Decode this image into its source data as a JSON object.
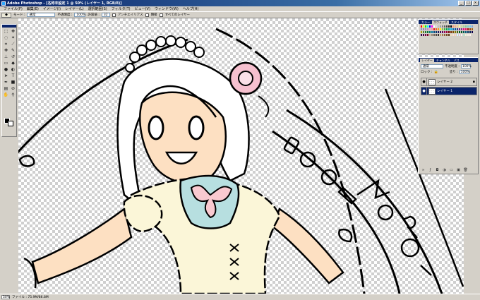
{
  "window": {
    "app_title": "Adobe Photoshop",
    "doc_title": "[名称未設定 1 @ 50% (レイヤー 1, RGB/8)]",
    "controls": [
      "_",
      "□",
      "×"
    ]
  },
  "menu": [
    "ファイル(F)",
    "編集(E)",
    "イメージ(I)",
    "レイヤー(L)",
    "選択範囲(S)",
    "フィルタ(T)",
    "ビュー(V)",
    "ウィンドウ(W)",
    "ヘルプ(H)"
  ],
  "options": {
    "mode_label": "モード :",
    "mode_value": "通常",
    "opacity_label": "不透明度 :",
    "opacity_value": "100%",
    "tolerance_label": "許容値 :",
    "tolerance_value": "32",
    "antialias_label": "アンチエイリアス",
    "contiguous_label": "隣接",
    "all_layers_label": "すべてのレイヤー"
  },
  "status": {
    "zoom": "50%",
    "doc_info": "ファイル : 75.9M/86.8M"
  },
  "swatch_colors": [
    "#ff0000",
    "#ffff00",
    "#00ff00",
    "#00ffff",
    "#0000ff",
    "#ff00ff",
    "#ffffff",
    "#e0e0e0",
    "#c0c0c0",
    "#a0a0a0",
    "#808080",
    "#606060",
    "#404040",
    "#202020",
    "#000000",
    "#f7977a",
    "#f9ad81",
    "#fdc68a",
    "#fff79a",
    "#c4df9b",
    "#a2d39c",
    "#82ca9d",
    "#7bcdc8",
    "#6ecff6",
    "#7ea7d8",
    "#8493ca",
    "#8882be",
    "#a187be",
    "#bc8dbf",
    "#f49ac2",
    "#f6989d",
    "#ed1c24",
    "#f26522",
    "#f7941d",
    "#fff200",
    "#8dc73f",
    "#39b54a",
    "#00a651",
    "#00a99d",
    "#00aeef",
    "#0072bc",
    "#0054a6",
    "#2e3192",
    "#662d91",
    "#92278f",
    "#ec008c",
    "#ed145b",
    "#9e0b0f",
    "#a0410d",
    "#a36209",
    "#aba000",
    "#598527",
    "#1a7b30",
    "#007236",
    "#00746b",
    "#0076a3",
    "#004b80",
    "#003471",
    "#1b1464",
    "#440e62",
    "#630460",
    "#9e005d",
    "#9e0039",
    "#790000",
    "#7b2e00",
    "#7d4900",
    "#827b00",
    "#406618",
    "#005e20",
    "#005826",
    "#005952",
    "#005b7f",
    "#003663",
    "#002157",
    "#0d004c",
    "#32004b",
    "#4b0049",
    "#7b0046",
    "#7a0026",
    "#c7b299",
    "#998675",
    "#736357",
    "#534741",
    "#37302d",
    "#c69c6d",
    "#a67c52",
    "#8c6239",
    "#754c24",
    "#603813",
    "#f0e0c0",
    "#fce4d6",
    "#ffd7c9",
    "#d7f4ff",
    "#e8dfff",
    "#ffeef5",
    "#b8e8d0",
    "#f5f5dc",
    "#faf0e6",
    "#fff5ee"
  ],
  "layers_panel": {
    "tabs": [
      "レイヤー",
      "チャンネル",
      "パス"
    ],
    "blend_mode": "通常",
    "opacity_label": "不透明度 :",
    "opacity_value": "100%",
    "fill_label": "塗り :",
    "fill_value": "100%",
    "lock_label": "ロック :",
    "layers": [
      {
        "name": "レイヤー 2",
        "locked": true
      },
      {
        "name": "レイヤー 1",
        "selected": true
      }
    ]
  },
  "swatches_panel": {
    "tabs": [
      "カラー",
      "スウォッチ",
      "スタイル"
    ]
  },
  "illustration": {
    "skin_color": "#fde0c2",
    "dress_color": "#fbf6d8",
    "collar_color": "#b7dfe0",
    "bow_color": "#f9c9d0",
    "flower_color": "#f6c0cf",
    "ink_color": "#000000"
  }
}
